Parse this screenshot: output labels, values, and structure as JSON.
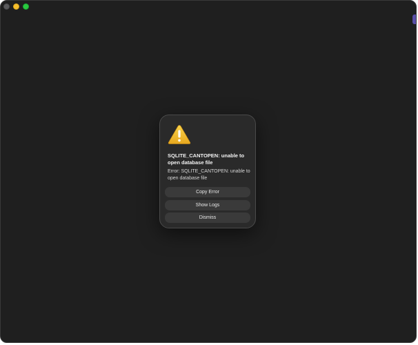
{
  "window": {
    "traffic_lights": [
      "close",
      "minimize",
      "zoom"
    ]
  },
  "dialog": {
    "icon": "warning-triangle-icon",
    "title": "SQLITE_CANTOPEN: unable to open database file",
    "message": "Error: SQLITE_CANTOPEN: unable to open database file",
    "buttons": {
      "copy": "Copy Error",
      "logs": "Show Logs",
      "dismiss": "Dismiss"
    }
  },
  "colors": {
    "window_bg": "#1f1f1f",
    "dialog_bg": "#2a2a2a",
    "button_bg": "#3a3a3a",
    "warning": "#f2c230"
  }
}
